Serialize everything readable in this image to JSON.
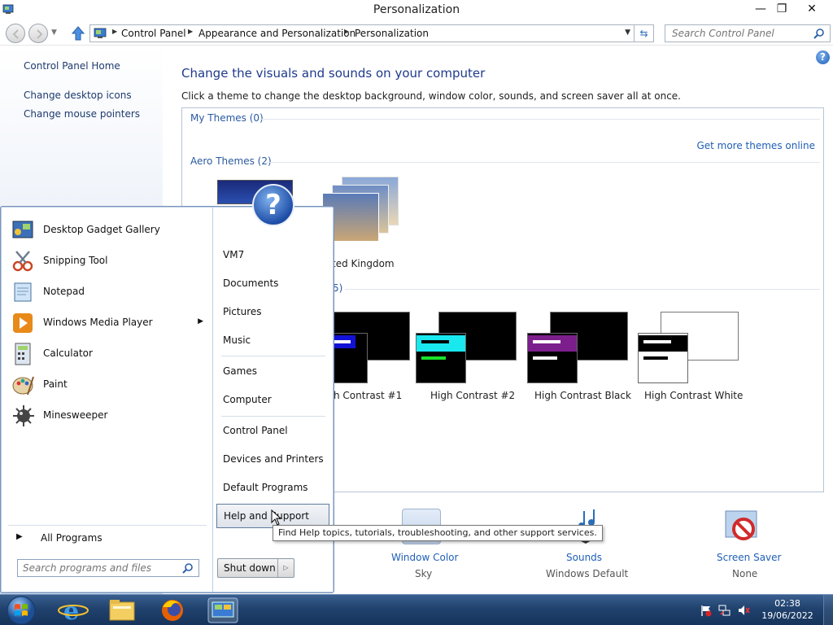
{
  "window": {
    "title": "Personalization",
    "controls": [
      "—",
      "❐",
      "✕"
    ]
  },
  "address": {
    "crumbs": [
      "Control Panel",
      "Appearance and Personalization",
      "Personalization"
    ],
    "search_placeholder": "Search Control Panel"
  },
  "sidebar": {
    "home": "Control Panel Home",
    "items": [
      "Change desktop icons",
      "Change mouse pointers"
    ]
  },
  "main": {
    "heading": "Change the visuals and sounds on your computer",
    "subtext": "Click a theme to change the desktop background, window color, sounds, and screen saver all at once.",
    "my_themes": "My Themes (0)",
    "get_more": "Get more themes online",
    "aero_themes": "Aero Themes (2)",
    "aero_visible_label": "ted Kingdom",
    "basic_group_count": "5)",
    "hc_themes": [
      "h Contrast #1",
      "High Contrast #2",
      "High Contrast Black",
      "High Contrast White"
    ]
  },
  "bottom": {
    "window_color": {
      "label": "Window Color",
      "value": "Sky"
    },
    "sounds": {
      "label": "Sounds",
      "value": "Windows Default"
    },
    "screen_saver": {
      "label": "Screen Saver",
      "value": "None"
    }
  },
  "startmenu": {
    "programs": [
      "Desktop Gadget Gallery",
      "Snipping Tool",
      "Notepad",
      "Windows Media Player",
      "Calculator",
      "Paint",
      "Minesweeper"
    ],
    "all_programs": "All Programs",
    "search_placeholder": "Search programs and files",
    "right_items": [
      "VM7",
      "Documents",
      "Pictures",
      "Music",
      "Games",
      "Computer",
      "Control Panel",
      "Devices and Printers",
      "Default Programs",
      "Help and Support"
    ],
    "shutdown": "Shut down",
    "tooltip": "Find Help topics, tutorials, troubleshooting, and other support services."
  },
  "taskbar": {
    "time": "02:38",
    "date": "19/06/2022"
  },
  "colors": {
    "link": "#1f5fb8",
    "heading": "#1e3a8c",
    "taskbar": "#20426e"
  }
}
